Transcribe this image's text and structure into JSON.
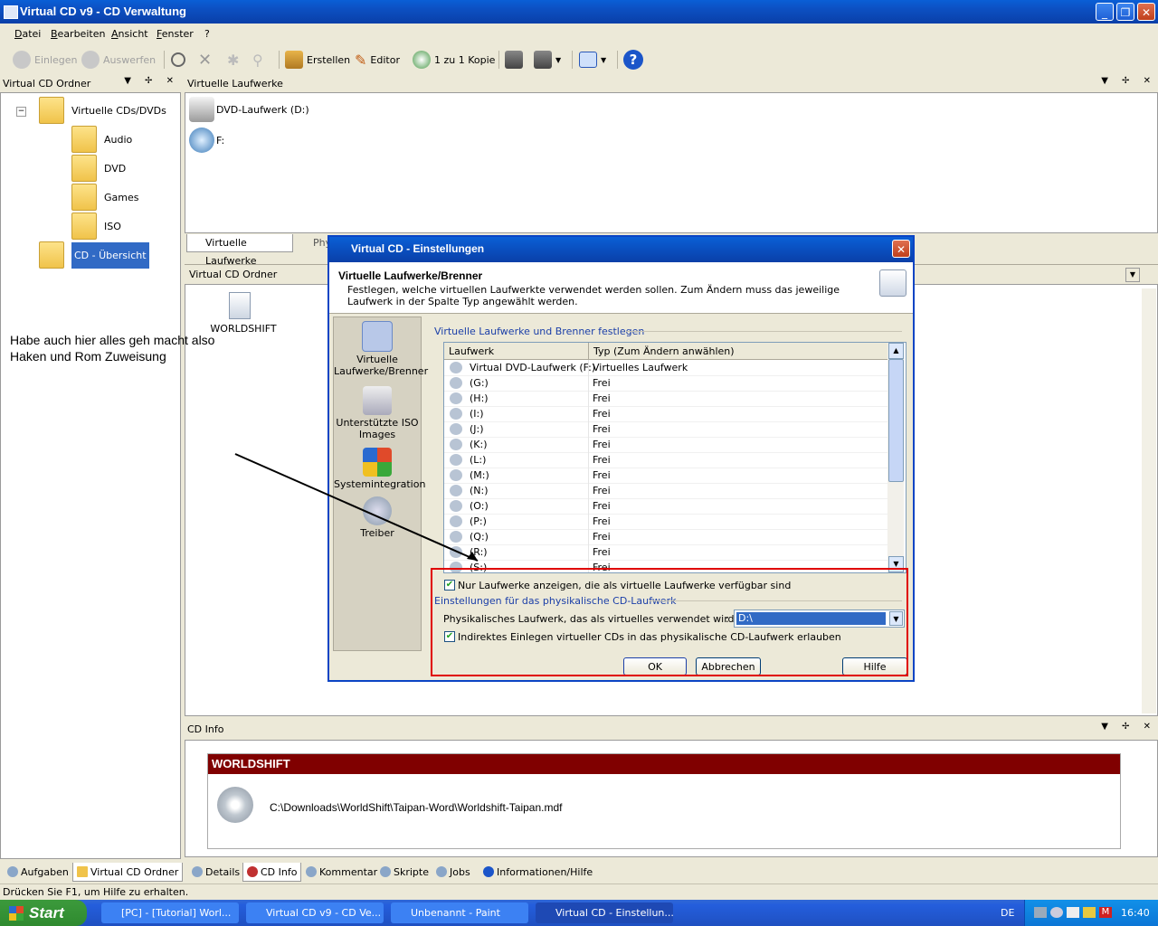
{
  "window": {
    "title": "Virtual CD v9 - CD Verwaltung"
  },
  "menu": [
    "Datei",
    "Bearbeiten",
    "Ansicht",
    "Fenster",
    "?"
  ],
  "toolbar": {
    "einlegen": "Einlegen",
    "auswerfen": "Auswerfen",
    "erstellen": "Erstellen",
    "editor": "Editor",
    "kopie": "1 zu 1 Kopie"
  },
  "left_panel": {
    "title": "Virtual CD Ordner",
    "root": "Virtuelle CDs/DVDs",
    "folders": [
      "Audio",
      "DVD",
      "Games",
      "ISO"
    ],
    "selected": "CD - Übersicht"
  },
  "drives_panel": {
    "title": "Virtuelle Laufwerke",
    "drives": [
      "DVD-Laufwerk (D:)",
      "F:"
    ],
    "tabs": [
      "Virtuelle Laufwerke",
      "Phy"
    ]
  },
  "folder_panel": {
    "title": "Virtual CD Ordner",
    "item": "WORLDSHIFT"
  },
  "annotation": {
    "line1": "Habe auch hier alles geh macht also",
    "line2": "Haken und Rom Zuweisung"
  },
  "info_panel": {
    "title": "CD Info",
    "name": "WORLDSHIFT",
    "path": "C:\\Downloads\\WorldShift\\Taipan-Word\\Worldshift-Taipan.mdf"
  },
  "bottom_tabs_left": [
    "Aufgaben",
    "Virtual CD Ordner"
  ],
  "bottom_tabs_right": [
    "Details",
    "CD Info",
    "Kommentar",
    "Skripte",
    "Jobs",
    "Informationen/Hilfe"
  ],
  "status": "Drücken Sie F1, um Hilfe zu erhalten.",
  "dialog": {
    "title": "Virtual CD - Einstellungen",
    "heading": "Virtuelle Laufwerke/Brenner",
    "desc": "Festlegen, welche virtuellen Laufwerkte verwendet werden sollen. Zum Ändern muss das jeweilige Laufwerk in der Spalte Typ angewählt werden.",
    "nav": [
      "Virtuelle Laufwerke/Brenner",
      "Unterstützte ISO Images",
      "Systemintegration",
      "Treiber"
    ],
    "group1": "Virtuelle Laufwerke und Brenner festlegen",
    "col1": "Laufwerk",
    "col2": "Typ (Zum Ändern anwählen)",
    "rows": [
      [
        "Virtual DVD-Laufwerk (F:)",
        "Virtuelles Laufwerk"
      ],
      [
        "(G:)",
        "Frei"
      ],
      [
        "(H:)",
        "Frei"
      ],
      [
        "(I:)",
        "Frei"
      ],
      [
        "(J:)",
        "Frei"
      ],
      [
        "(K:)",
        "Frei"
      ],
      [
        "(L:)",
        "Frei"
      ],
      [
        "(M:)",
        "Frei"
      ],
      [
        "(N:)",
        "Frei"
      ],
      [
        "(O:)",
        "Frei"
      ],
      [
        "(P:)",
        "Frei"
      ],
      [
        "(Q:)",
        "Frei"
      ],
      [
        "(R:)",
        "Frei"
      ],
      [
        "(S:)",
        "Frei"
      ]
    ],
    "check1": "Nur Laufwerke anzeigen, die als virtuelle Laufwerke verfügbar sind",
    "group2": "Einstellungen für das physikalische CD-Laufwerk",
    "phys_label": "Physikalisches Laufwerk, das als virtuelles verwendet wird",
    "phys_value": "D:\\",
    "check2": "Indirektes Einlegen virtueller CDs in das physikalische CD-Laufwerk erlauben",
    "ok": "OK",
    "cancel": "Abbrechen",
    "help": "Hilfe"
  },
  "taskbar": {
    "start": "Start",
    "tasks": [
      "[PC] - [Tutorial] Worl...",
      "Virtual CD v9 - CD Ve...",
      "Unbenannt - Paint",
      "Virtual CD - Einstellun..."
    ],
    "lang": "DE",
    "clock": "16:40"
  },
  "colors": {
    "accent": "#0a3fa8",
    "highlight": "#e00000",
    "info_bar": "#800000"
  }
}
